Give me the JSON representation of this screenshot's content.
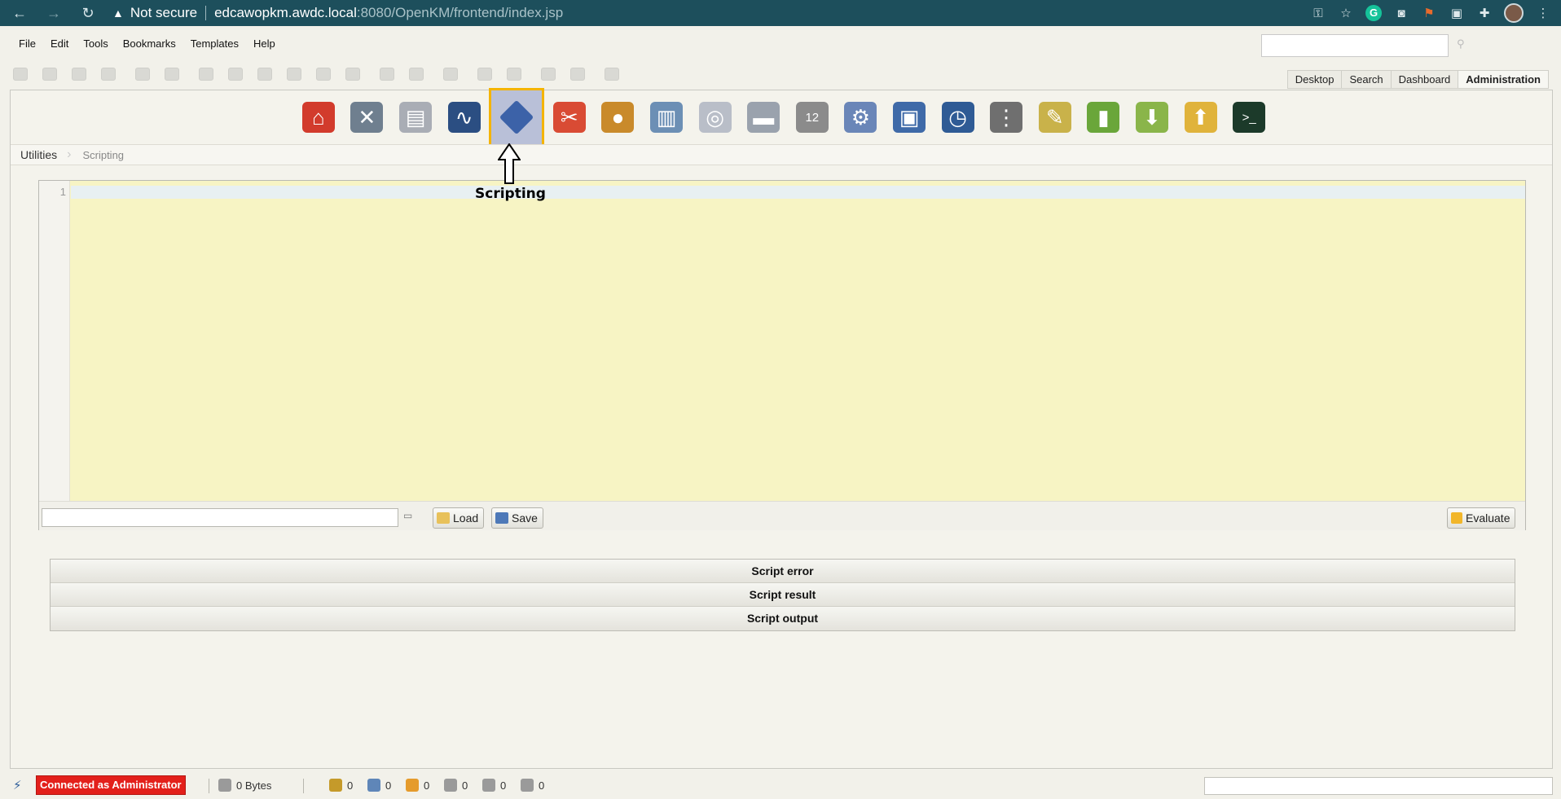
{
  "browser": {
    "security_label": "Not secure",
    "url_host": "edcawopkm.awdc.local",
    "url_rest": ":8080/OpenKM/frontend/index.jsp"
  },
  "menu": [
    "File",
    "Edit",
    "Tools",
    "Bookmarks",
    "Templates",
    "Help"
  ],
  "tabs": [
    {
      "label": "Desktop"
    },
    {
      "label": "Search"
    },
    {
      "label": "Dashboard"
    },
    {
      "label": "Administration",
      "active": true
    }
  ],
  "admin_icons": [
    {
      "name": "home-icon",
      "glyph": "⌂",
      "color": "#d23b2c"
    },
    {
      "name": "tools-icon",
      "glyph": "✕",
      "color": "#6f7f8f"
    },
    {
      "name": "preview-icon",
      "glyph": "▤",
      "color": "#a9adb5"
    },
    {
      "name": "monitor-icon",
      "glyph": "∿",
      "color": "#2b4e82"
    },
    {
      "name": "scripting-icon",
      "glyph": "",
      "color": "#3c62a8",
      "selected": true
    },
    {
      "name": "scissors-icon",
      "glyph": "✂",
      "color": "#d94b34"
    },
    {
      "name": "users-icon",
      "glyph": "●",
      "color": "#c98a2b"
    },
    {
      "name": "database-icon",
      "glyph": "▥",
      "color": "#6c8fb5"
    },
    {
      "name": "search-doc-icon",
      "glyph": "◎",
      "color": "#b9bec8"
    },
    {
      "name": "scanner-icon",
      "glyph": "▬",
      "color": "#9aa2ad"
    },
    {
      "name": "calendar-icon",
      "glyph": "12",
      "color": "#8b8b8b"
    },
    {
      "name": "gear-icon",
      "glyph": "⚙",
      "color": "#6a86b8"
    },
    {
      "name": "properties-icon",
      "glyph": "▣",
      "color": "#3f6aa8"
    },
    {
      "name": "clock-icon",
      "glyph": "◷",
      "color": "#2f5b95"
    },
    {
      "name": "list-icon",
      "glyph": "⋮",
      "color": "#6f6f6f"
    },
    {
      "name": "brush-icon",
      "glyph": "✎",
      "color": "#c9b24a"
    },
    {
      "name": "books-icon",
      "glyph": "▮",
      "color": "#6aa63a"
    },
    {
      "name": "import-icon",
      "glyph": "⬇",
      "color": "#8ab54a"
    },
    {
      "name": "export-icon",
      "glyph": "⬆",
      "color": "#e0b33b"
    },
    {
      "name": "terminal-icon",
      "glyph": ">_",
      "color": "#1c3a2a"
    }
  ],
  "breadcrumb": {
    "root": "Utilities",
    "current": "Scripting"
  },
  "callout": {
    "label": "Scripting"
  },
  "editor": {
    "line_numbers": [
      "1"
    ],
    "path_value": "",
    "load_label": "Load",
    "save_label": "Save",
    "evaluate_label": "Evaluate"
  },
  "sections": [
    {
      "title": "Script error"
    },
    {
      "title": "Script result"
    },
    {
      "title": "Script output"
    }
  ],
  "status": {
    "connection": "Connected as Administrator",
    "size": "0 Bytes",
    "counters": [
      {
        "icon": "lock-icon",
        "value": "0",
        "color": "#c59a2a"
      },
      {
        "icon": "edit-icon",
        "value": "0",
        "color": "#5f86b8"
      },
      {
        "icon": "mail-icon",
        "value": "0",
        "color": "#e59b2c"
      },
      {
        "icon": "tag-icon",
        "value": "0",
        "color": "#9a9a9a"
      },
      {
        "icon": "gear-small-icon",
        "value": "0",
        "color": "#9a9a9a"
      },
      {
        "icon": "clip-icon",
        "value": "0",
        "color": "#9a9a9a"
      }
    ]
  }
}
